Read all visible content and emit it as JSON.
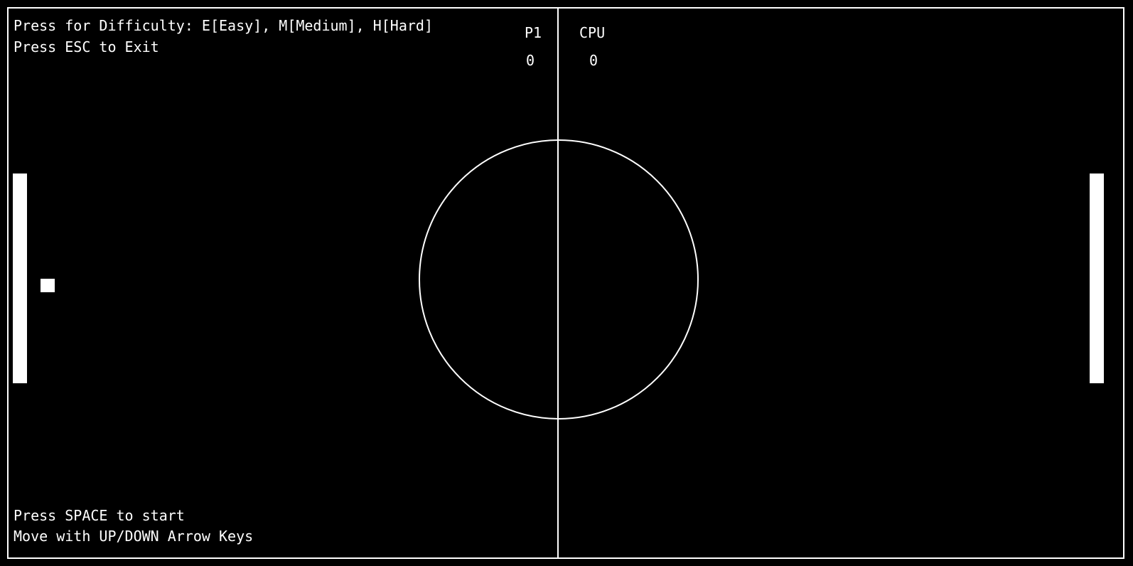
{
  "hud": {
    "difficulty_prompt": "Press for Difficulty: E[Easy], M[Medium], H[Hard]",
    "exit_prompt": "Press ESC to Exit",
    "start_prompt": "Press SPACE to start",
    "controls_prompt": "Move with UP/DOWN Arrow Keys"
  },
  "scoreboard": {
    "player1_label": "P1",
    "player1_score": "0",
    "cpu_label": "CPU",
    "cpu_score": "0"
  },
  "colors": {
    "background": "#000000",
    "foreground": "#ffffff"
  }
}
